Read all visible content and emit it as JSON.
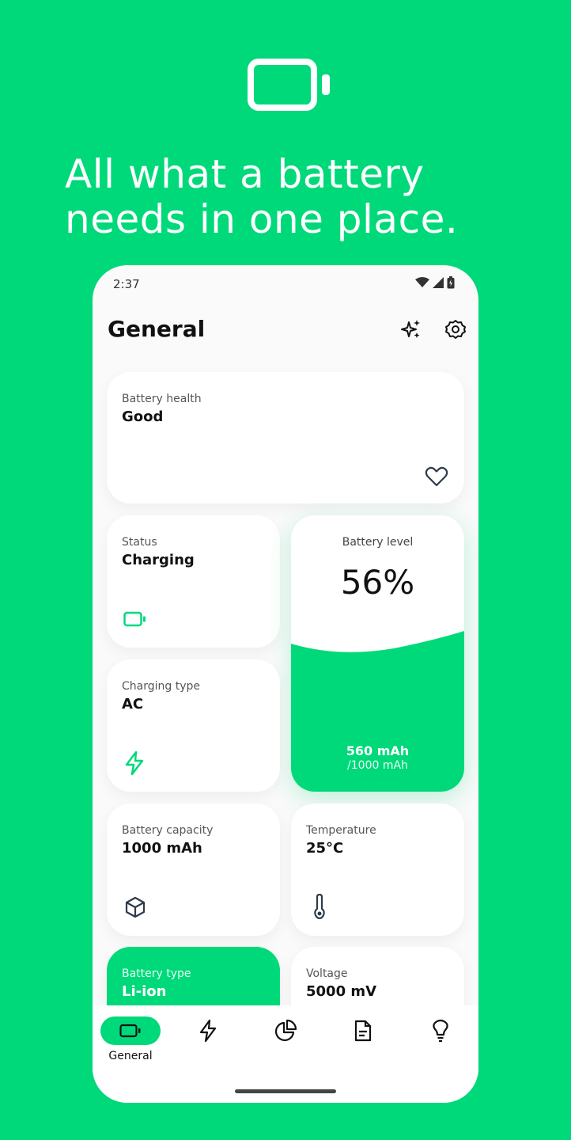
{
  "headline": {
    "line1": "All what a battery",
    "line2": "needs in one place."
  },
  "status_bar": {
    "time": "2:37"
  },
  "app": {
    "title": "General"
  },
  "cards": {
    "battery_health": {
      "label": "Battery health",
      "value": "Good",
      "icon": "heart-icon"
    },
    "status": {
      "label": "Status",
      "value": "Charging",
      "icon": "battery-icon"
    },
    "battery_level": {
      "label": "Battery level",
      "percent": "56%",
      "current": "560 mAh",
      "total": "/1000 mAh",
      "level_fraction": 0.56
    },
    "charging_type": {
      "label": "Charging type",
      "value": "AC",
      "icon": "lightning-icon"
    },
    "battery_capacity": {
      "label": "Battery capacity",
      "value": "1000 mAh",
      "icon": "cube-icon"
    },
    "temperature": {
      "label": "Temperature",
      "value": "25°C",
      "icon": "thermometer-icon"
    },
    "battery_type": {
      "label": "Battery type",
      "value": "Li-ion"
    },
    "voltage": {
      "label": "Voltage",
      "value": "5000 mV"
    }
  },
  "nav": {
    "items": [
      {
        "label": "General",
        "icon": "battery-icon",
        "active": true
      },
      {
        "label": "",
        "icon": "lightning-icon",
        "active": false
      },
      {
        "label": "",
        "icon": "pie-chart-icon",
        "active": false
      },
      {
        "label": "",
        "icon": "document-icon",
        "active": false
      },
      {
        "label": "",
        "icon": "lightbulb-icon",
        "active": false
      }
    ]
  },
  "colors": {
    "accent": "#00d97a",
    "card": "#ffffff",
    "phone_bg": "#fafafa",
    "text": "#111111",
    "icon": "#2d3a4a"
  }
}
